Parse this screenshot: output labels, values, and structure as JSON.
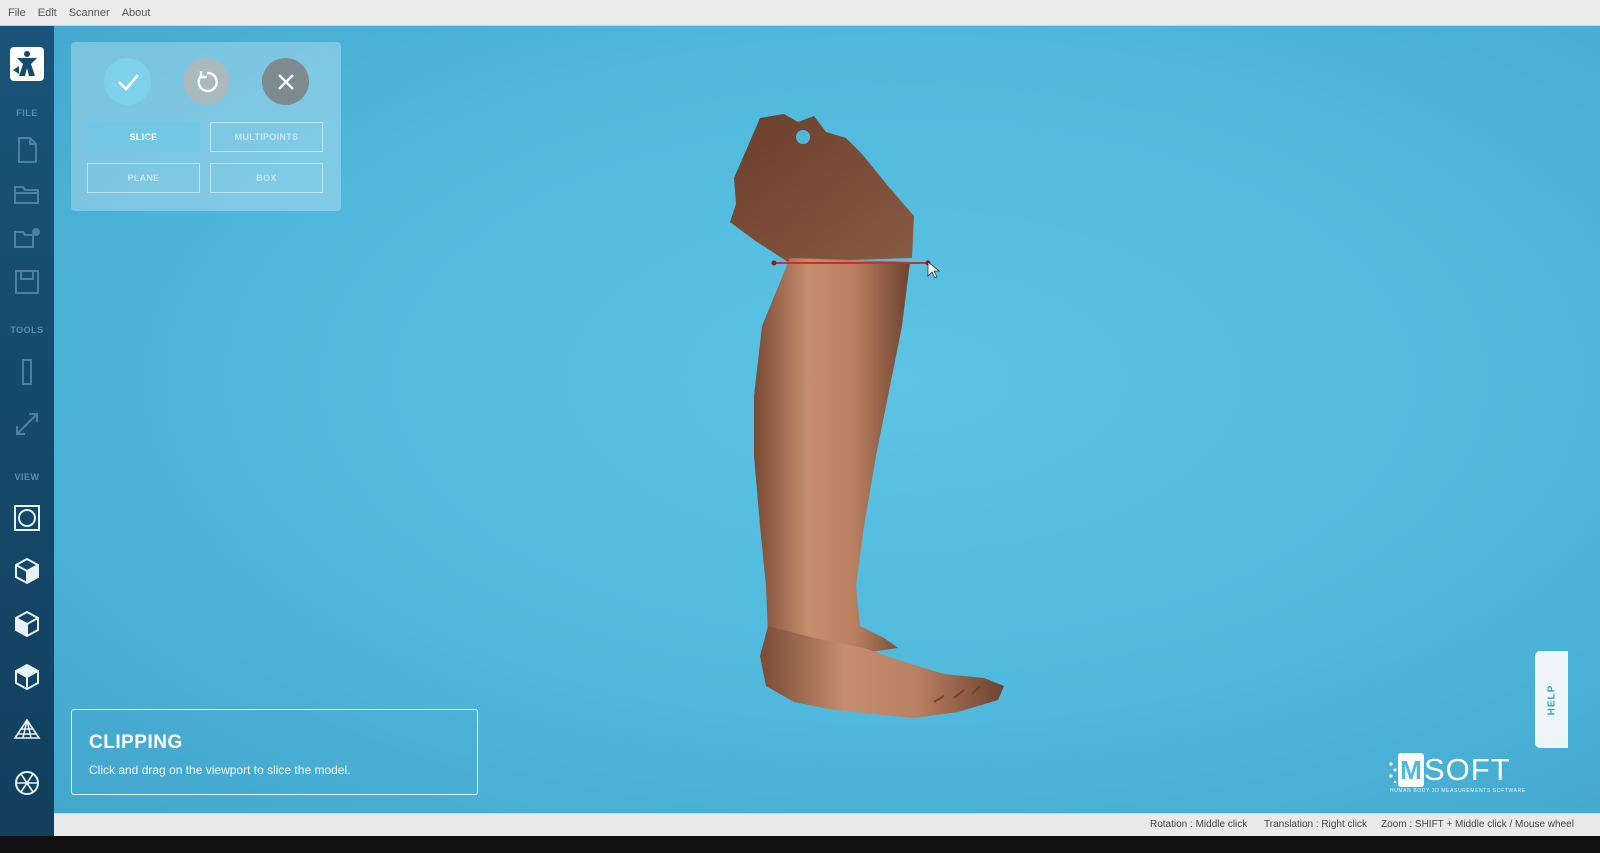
{
  "menu": [
    "File",
    "Edit",
    "Scanner",
    "About"
  ],
  "sidebar": {
    "sections": {
      "file": "FILE",
      "tools": "TOOLS",
      "view": "VIEW"
    },
    "file_icons": [
      "new-file-icon",
      "open-folder-icon",
      "open-recent-icon",
      "save-icon"
    ],
    "tool_icons": [
      "ruler-icon",
      "expand-icon"
    ],
    "view_icons": [
      "fit-view-icon",
      "cube-front-icon",
      "cube-side-icon",
      "cube-top-icon",
      "perspective-grid-icon",
      "wireframe-icon"
    ]
  },
  "clip_panel": {
    "actions": [
      "confirm-icon",
      "reset-icon",
      "cancel-icon"
    ],
    "modes": [
      "SLICE",
      "MULTIPOINTS",
      "PLANE",
      "BOX"
    ],
    "active_mode": "SLICE"
  },
  "info": {
    "title": "CLIPPING",
    "description": "Click and drag on the viewport to slice the model."
  },
  "help_label": "HELP",
  "brand": {
    "name": "SOFT",
    "mark": "M",
    "tagline": "HUMAN BODY 3D MEASUREMENTS SOFTWARE"
  },
  "status": {
    "rotation": "Rotation : Middle click",
    "translation": "Translation : Right click",
    "zoom": "Zoom : SHIFT + Middle click / Mouse wheel"
  },
  "colors": {
    "viewport": "#4fb8dc",
    "sidebar": "#164a6e",
    "slice_line": "#d62a2a",
    "model": "#b07a5c"
  }
}
